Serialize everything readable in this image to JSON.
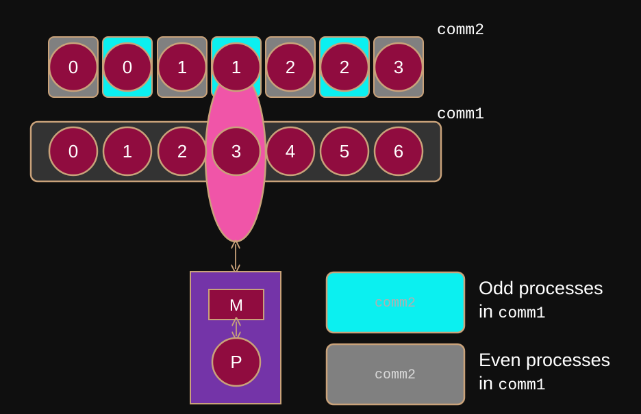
{
  "labels": {
    "comm2_label": "comm2",
    "comm1_label": "comm1",
    "memory": "M",
    "processor": "P"
  },
  "comm2_row": {
    "ranks": [
      "0",
      "0",
      "1",
      "1",
      "2",
      "2",
      "3"
    ],
    "box_colors": [
      "gray",
      "cyan",
      "gray",
      "cyan",
      "gray",
      "cyan",
      "gray"
    ]
  },
  "comm1_row": {
    "ranks": [
      "0",
      "1",
      "2",
      "3",
      "4",
      "5",
      "6"
    ]
  },
  "legend": {
    "odd": {
      "box_label": "comm2",
      "line1": "Odd processes",
      "line2_prefix": "in ",
      "line2_code": "comm1"
    },
    "even": {
      "box_label": "comm2",
      "line1": "Even processes",
      "line2_prefix": "in ",
      "line2_code": "comm1"
    }
  },
  "colors": {
    "background": "#0f0f0f",
    "process_circle": "#900c3f",
    "circle_border": "#c9a27a",
    "cyan_box": "#0bf0f0",
    "gray_box": "#808080",
    "comm1_bar": "#333333",
    "highlight_oval": "#f055a8",
    "node_box": "#7434a8"
  }
}
